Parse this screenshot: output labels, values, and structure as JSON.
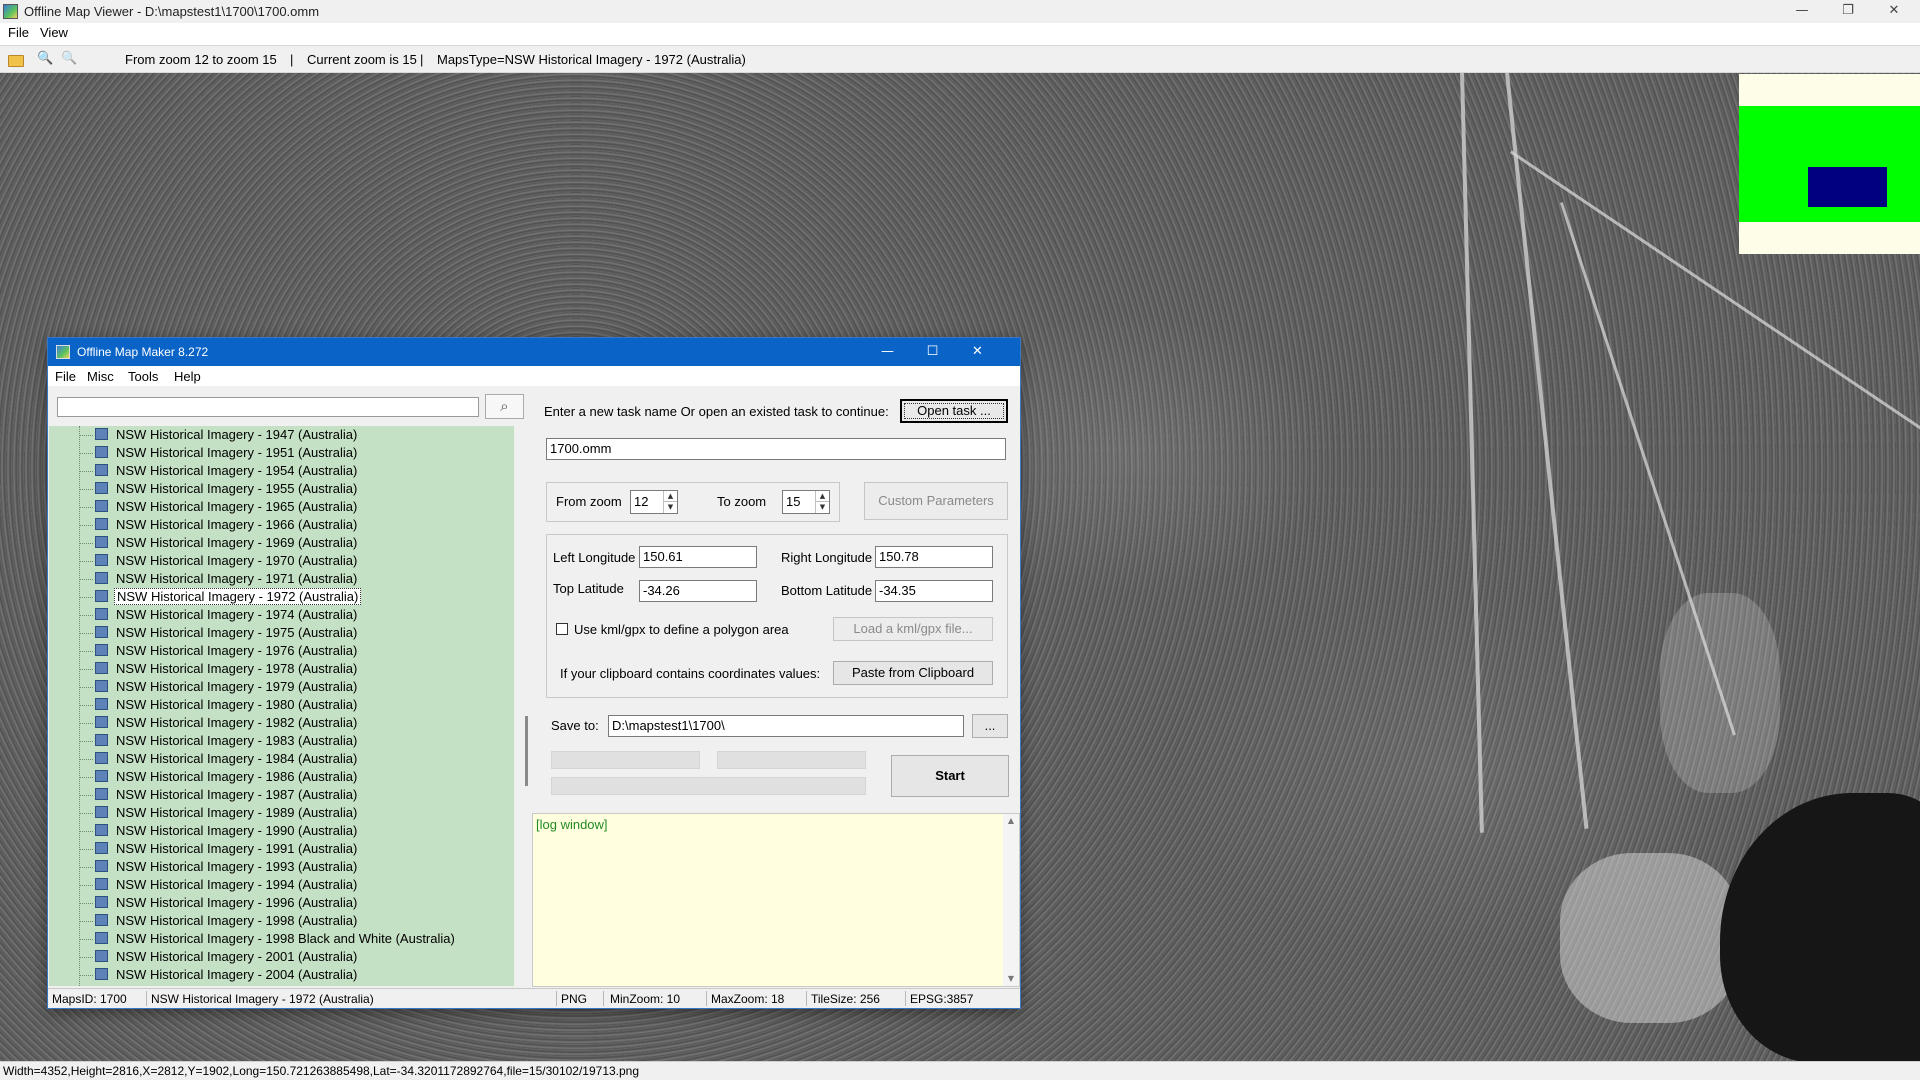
{
  "viewer": {
    "title": "Offline Map Viewer - D:\\mapstest1\\1700\\1700.omm",
    "window_controls": {
      "minimize": "—",
      "restore": "❐",
      "close": "✕"
    },
    "menu": [
      "File",
      "View"
    ],
    "toolbar": {
      "open_icon": "folder-open-icon",
      "zoom_out_icon": "🔍",
      "zoom_in_icon": "🔍",
      "zoom_range_info": "From zoom 12 to zoom 15",
      "separator": "|",
      "current_zoom_info": "Current zoom is 15",
      "maps_type_info": "MapsType=NSW Historical Imagery - 1972 (Australia)"
    },
    "status": "Width=4352,Height=2816,X=2812,Y=1902,Long=150.721263885498,Lat=-34.3201172892764,file=15/30102/19713.png"
  },
  "dialog": {
    "title": "Offline Map Maker 8.272",
    "window_controls": {
      "minimize": "—",
      "maximize": "☐",
      "close": "✕"
    },
    "menu": [
      "File",
      "Misc",
      "Tools",
      "Help"
    ],
    "search": {
      "value": "",
      "icon": "⌕"
    },
    "tree_items": [
      "NSW Historical Imagery - 1947 (Australia)",
      "NSW Historical Imagery - 1951 (Australia)",
      "NSW Historical Imagery - 1954 (Australia)",
      "NSW Historical Imagery - 1955 (Australia)",
      "NSW Historical Imagery - 1965 (Australia)",
      "NSW Historical Imagery - 1966 (Australia)",
      "NSW Historical Imagery - 1969 (Australia)",
      "NSW Historical Imagery - 1970 (Australia)",
      "NSW Historical Imagery - 1971 (Australia)",
      "NSW Historical Imagery - 1972 (Australia)",
      "NSW Historical Imagery - 1974 (Australia)",
      "NSW Historical Imagery - 1975 (Australia)",
      "NSW Historical Imagery - 1976 (Australia)",
      "NSW Historical Imagery - 1978 (Australia)",
      "NSW Historical Imagery - 1979 (Australia)",
      "NSW Historical Imagery - 1980 (Australia)",
      "NSW Historical Imagery - 1982 (Australia)",
      "NSW Historical Imagery - 1983 (Australia)",
      "NSW Historical Imagery - 1984 (Australia)",
      "NSW Historical Imagery - 1986 (Australia)",
      "NSW Historical Imagery - 1987 (Australia)",
      "NSW Historical Imagery - 1989 (Australia)",
      "NSW Historical Imagery - 1990 (Australia)",
      "NSW Historical Imagery - 1991 (Australia)",
      "NSW Historical Imagery - 1993 (Australia)",
      "NSW Historical Imagery - 1994 (Australia)",
      "NSW Historical Imagery - 1996 (Australia)",
      "NSW Historical Imagery - 1998 (Australia)",
      "NSW Historical Imagery - 1998 Black and White (Australia)",
      "NSW Historical Imagery - 2001 (Australia)",
      "NSW Historical Imagery - 2004 (Australia)"
    ],
    "selected_item": "NSW Historical Imagery - 1972 (Australia)",
    "task_prompt": "Enter a new task name Or open an existed task to continue:",
    "open_task_label": "Open task ...",
    "task_name": "1700.omm",
    "from_zoom_label": "From zoom",
    "from_zoom_value": "12",
    "to_zoom_label": "To zoom",
    "to_zoom_value": "15",
    "spin_up": "▲",
    "spin_down": "▼",
    "custom_params_label": "Custom Parameters",
    "left_lon_label": "Left Longitude",
    "left_lon_value": "150.61",
    "right_lon_label": "Right Longitude",
    "right_lon_value": "150.78",
    "top_lat_label": "Top Latitude",
    "top_lat_value": "-34.26",
    "bottom_lat_label": "Bottom Latitude",
    "bottom_lat_value": "-34.35",
    "kml_check_label": "Use kml/gpx to define a polygon area",
    "load_kml_label": "Load a kml/gpx file...",
    "clipboard_prompt": "If your clipboard contains coordinates values:",
    "paste_label": "Paste from Clipboard",
    "save_to_label": "Save to:",
    "save_to_value": "D:\\mapstest1\\1700\\",
    "browse_label": "...",
    "start_label": "Start",
    "log_text": "[log window]",
    "status": {
      "maps_id": "MapsID: 1700",
      "maps_name": "NSW Historical Imagery - 1972 (Australia)",
      "format": "PNG",
      "min_zoom": "MinZoom: 10",
      "max_zoom": "MaxZoom: 18",
      "tile_size": "TileSize: 256",
      "epsg": "EPSG:3857"
    }
  }
}
